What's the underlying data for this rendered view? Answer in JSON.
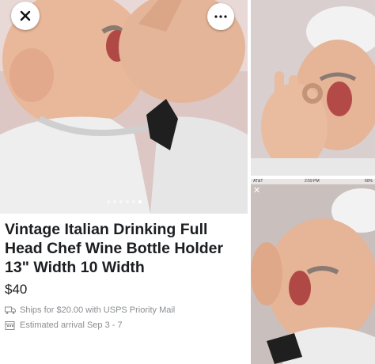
{
  "listing": {
    "title": "Vintage Italian Drinking Full Head Chef Wine Bottle Holder 13\" Width 10 Width",
    "price": "$40",
    "shipping": "Ships for $20.00 with USPS Priority Mail",
    "arrival": "Estimated arrival Sep 3 - 7",
    "photo_count": 6,
    "active_photo": 6
  },
  "controls": {
    "close_icon": "close-icon",
    "more_icon": "more-options-icon",
    "shipping_icon": "truck-icon",
    "arrival_icon": "calendar-icon",
    "accent_color": "#1c1e21"
  },
  "overlay_screenshot": {
    "carrier": "AT&T",
    "time": "2:59 PM",
    "battery": "60%"
  }
}
